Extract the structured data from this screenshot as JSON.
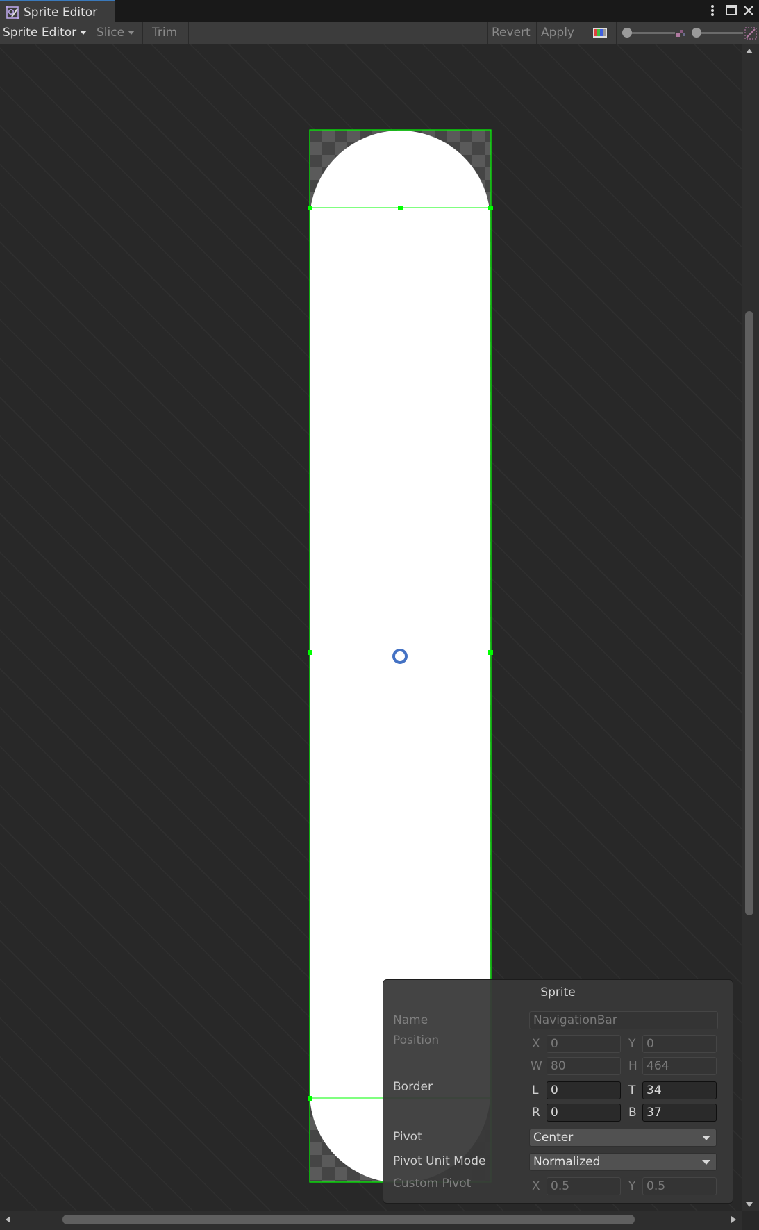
{
  "window": {
    "tab_title": "Sprite Editor",
    "menu_icon": "more-vertical-icon",
    "maximize_icon": "maximize-icon",
    "close_icon": "close-icon"
  },
  "toolbar": {
    "mode_label": "Sprite Editor",
    "slice_label": "Slice",
    "trim_label": "Trim",
    "revert_label": "Revert",
    "apply_label": "Apply",
    "color_channels_icon": "color-channels-icon",
    "zoom_slider_value": 0.0,
    "mip_slider_value": 0.0
  },
  "sprite": {
    "fill_color": "#ffffff",
    "outline_color": "#00ff00",
    "pivot_color": "#4472c4"
  },
  "panel": {
    "title": "Sprite",
    "name_label": "Name",
    "name_value": "NavigationBar",
    "position_label": "Position",
    "x_label": "X",
    "x_value": "0",
    "y_label": "Y",
    "y_value": "0",
    "w_label": "W",
    "w_value": "80",
    "h_label": "H",
    "h_value": "464",
    "border_label": "Border",
    "l_label": "L",
    "l_value": "0",
    "t_label": "T",
    "t_value": "34",
    "r_label": "R",
    "r_value": "0",
    "b_label": "B",
    "b_value": "37",
    "pivot_label": "Pivot",
    "pivot_value": "Center",
    "pivot_unit_label": "Pivot Unit Mode",
    "pivot_unit_value": "Normalized",
    "custom_pivot_label": "Custom Pivot",
    "cx_label": "X",
    "cx_value": "0.5",
    "cy_label": "Y",
    "cy_value": "0.5"
  }
}
